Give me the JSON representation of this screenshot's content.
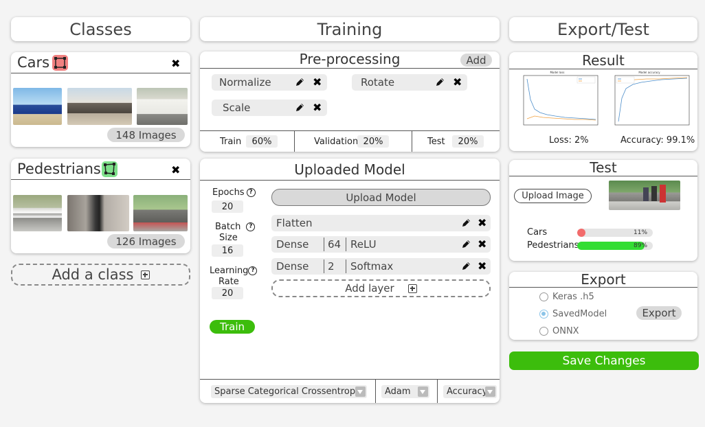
{
  "headers": {
    "classes": "Classes",
    "training": "Training",
    "export_test": "Export/Test"
  },
  "classes": [
    {
      "name": "Cars",
      "icon": "bounding-box-icon",
      "icon_color": "#f08080",
      "count_label": "148 Images"
    },
    {
      "name": "Pedestrians",
      "icon": "polygon-icon",
      "icon_color": "#7ee08a",
      "count_label": "126 Images"
    }
  ],
  "add_class_label": "Add a class",
  "preprocessing": {
    "title": "Pre-processing",
    "add_label": "Add",
    "items": [
      "Normalize",
      "Rotate",
      "Scale"
    ],
    "splits": [
      {
        "label": "Train",
        "value": "60%"
      },
      {
        "label": "Validation",
        "value": "20%"
      },
      {
        "label": "Test",
        "value": "20%"
      }
    ]
  },
  "model": {
    "title": "Uploaded Model",
    "upload_label": "Upload Model",
    "params": {
      "epochs_label": "Epochs",
      "epochs_value": "20",
      "batch_label_1": "Batch",
      "batch_label_2": "Size",
      "batch_value": "16",
      "lr_label_1": "Learning",
      "lr_label_2": "Rate",
      "lr_value": "20"
    },
    "layers": [
      {
        "type": "Flatten",
        "units": "",
        "activation": ""
      },
      {
        "type": "Dense",
        "units": "64",
        "activation": "ReLU"
      },
      {
        "type": "Dense",
        "units": "2",
        "activation": "Softmax"
      }
    ],
    "add_layer_label": "Add layer",
    "train_label": "Train",
    "loss_fn": "Sparse Categorical Crossentropy",
    "optimizer": "Adam",
    "metric": "Accuracy"
  },
  "result": {
    "title": "Result",
    "loss_chart_title": "Model loss",
    "acc_chart_title": "Model accuracy",
    "loss_label": "Loss: 2%",
    "acc_label": "Accuracy: 99.1%"
  },
  "test": {
    "title": "Test",
    "upload_label": "Upload Image",
    "predictions": [
      {
        "label": "Cars",
        "percent_label": "11%",
        "fraction": 0.11,
        "color": "#f26b6b"
      },
      {
        "label": "Pedestrians",
        "percent_label": "89%",
        "fraction": 0.89,
        "color": "#33dd33"
      }
    ]
  },
  "export": {
    "title": "Export",
    "options": [
      "Keras .h5",
      "SavedModel",
      "ONNX"
    ],
    "selected": "SavedModel",
    "export_label": "Export"
  },
  "save_label": "Save Changes",
  "colors": {
    "accent_green": "#3cbd0c",
    "pill_gray": "#d9d9d9"
  }
}
